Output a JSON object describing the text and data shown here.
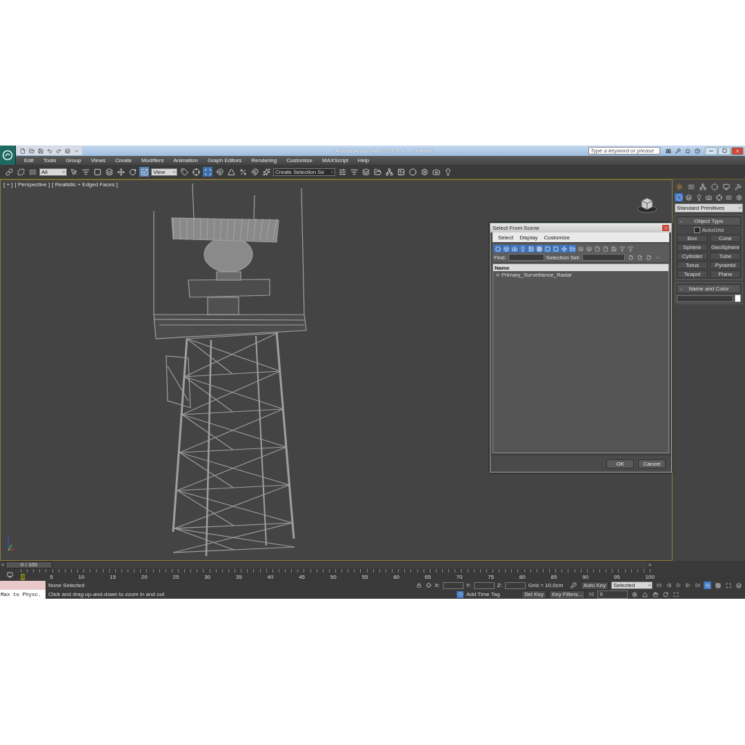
{
  "title_bar": {
    "app_title": "Autodesk 3ds Max 2012 x64",
    "document": "Untitled",
    "search": {
      "placeholder": "Type a keyword or phrase"
    }
  },
  "menu": [
    "Edit",
    "Tools",
    "Group",
    "Views",
    "Create",
    "Modifiers",
    "Animation",
    "Graph Editors",
    "Rendering",
    "Customize",
    "MAXScript",
    "Help"
  ],
  "toolbar": {
    "selection_filter": "All",
    "reference_coord": "View",
    "named_selection": "Create Selection Se"
  },
  "viewport": {
    "labels": [
      "[ + ]",
      "[ Perspective ]",
      "[ Realistic + Edged Faces ]"
    ]
  },
  "dialog": {
    "title": "Select From Scene",
    "menu": [
      "Select",
      "Display",
      "Customize"
    ],
    "find_label": "Find:",
    "selection_set_label": "Selection Set:",
    "column": "Name",
    "rows": [
      {
        "name": "Primary_Surveillance_Radar",
        "selected": false
      }
    ],
    "buttons": [
      "OK",
      "Cancel"
    ]
  },
  "command_panel": {
    "category": "Standard Primitives",
    "object_type": {
      "title": "Object Type",
      "collapse": "-",
      "autogrid": {
        "label": "AutoGrid",
        "checked": false
      },
      "buttons": [
        "Box",
        "Cone",
        "Sphere",
        "GeoSphere",
        "Cylinder",
        "Tube",
        "Torus",
        "Pyramid",
        "Teapot",
        "Plane"
      ]
    },
    "name_and_color": {
      "title": "Name and Color",
      "collapse": "-",
      "color": "#ffffff"
    }
  },
  "time_slider": {
    "prev": "<",
    "position": "0 / 100",
    "next": ">",
    "level": 0
  },
  "track_bar": {
    "ticks": [
      "0",
      "5",
      "10",
      "15",
      "20",
      "25",
      "30",
      "35",
      "40",
      "45",
      "50",
      "55",
      "60",
      "65",
      "70",
      "75",
      "80",
      "85",
      "90",
      "95",
      "100"
    ]
  },
  "status": {
    "script_listener": "Max to Physc.",
    "selection": "None Selected",
    "prompt": "Click and drag up-and-down to zoom in and out",
    "coords": [
      "X:",
      "Y:",
      "Z:"
    ],
    "grid": "Grid = 10,0cm",
    "time_tag": "Add Time Tag",
    "auto_key": "Auto Key",
    "key_mode": "Selected",
    "set_key": "Set Key",
    "key_filters": "Key Filters...",
    "frame": "0"
  }
}
